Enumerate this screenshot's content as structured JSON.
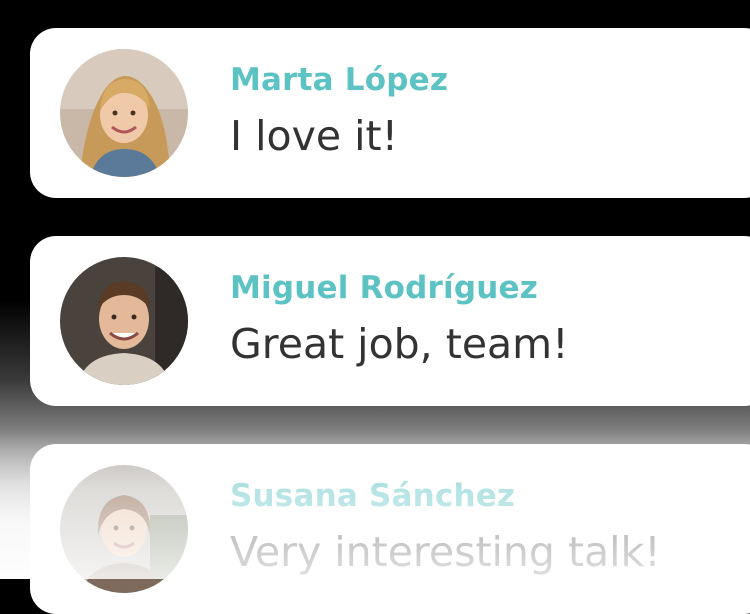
{
  "colors": {
    "name_accent": "#5cc2c4",
    "message_text": "#333333",
    "card_background": "#ffffff"
  },
  "comments": [
    {
      "name": "Marta López",
      "message": "I love it!",
      "avatar_icon": "avatar-woman-blonde"
    },
    {
      "name": "Miguel Rodríguez",
      "message": "Great job, team!",
      "avatar_icon": "avatar-man-smiling"
    },
    {
      "name": "Susana Sánchez",
      "message": "Very interesting talk!",
      "avatar_icon": "avatar-woman-brunette"
    }
  ]
}
